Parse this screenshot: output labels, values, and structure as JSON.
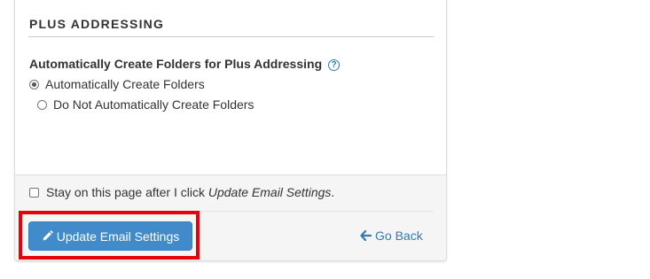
{
  "section": {
    "title": "PLUS ADDRESSING",
    "option_heading": "Automatically Create Folders for Plus Addressing",
    "help_icon": "question-circle-icon",
    "options": [
      {
        "label": "Automatically Create Folders",
        "selected": true
      },
      {
        "label": "Do Not Automatically Create Folders",
        "selected": false
      }
    ]
  },
  "footer": {
    "stay_label_prefix": "Stay on this page after I click ",
    "stay_label_emphasis": "Update Email Settings",
    "stay_label_suffix": ".",
    "stay_checked": false,
    "update_button_label": "Update Email Settings",
    "update_button_icon": "pencil-icon",
    "go_back_label": "Go Back",
    "go_back_icon": "arrow-left-icon"
  },
  "colors": {
    "primary": "#428bca",
    "link": "#337ab7",
    "highlight": "#e8000b"
  }
}
